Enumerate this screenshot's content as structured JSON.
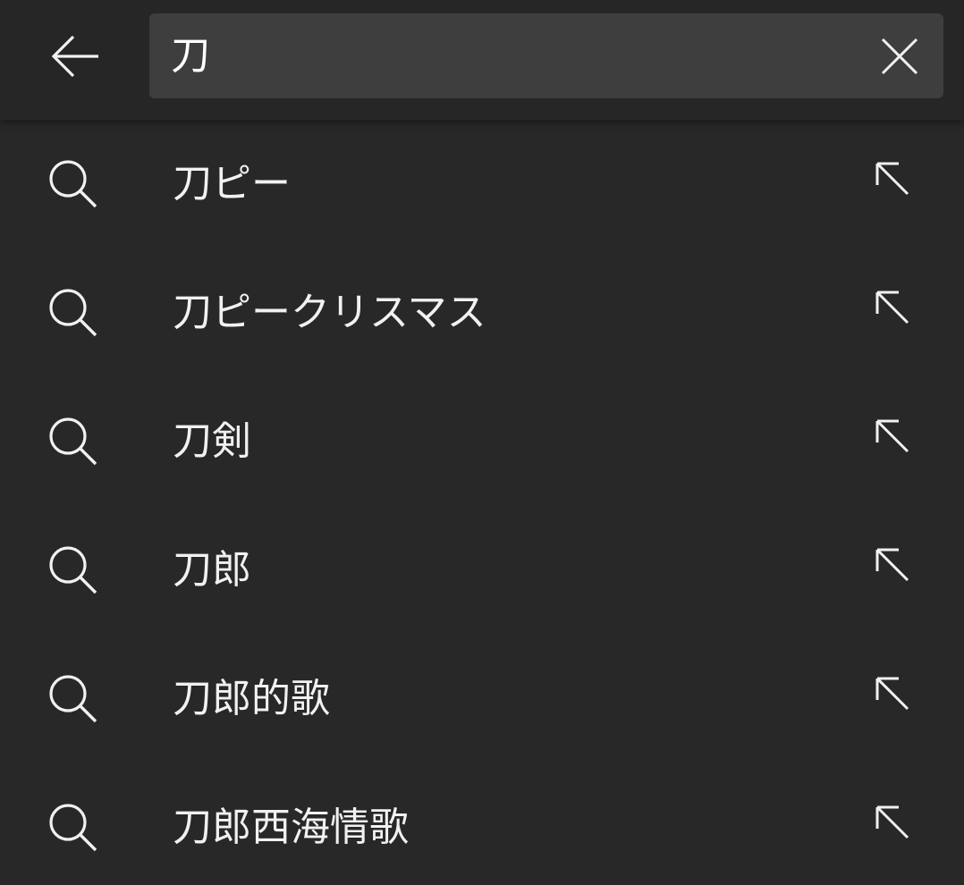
{
  "search": {
    "value": "刀",
    "icons": {
      "back": "arrow-left-icon",
      "clear": "close-icon"
    }
  },
  "suggestions": [
    {
      "text": "刀ピー",
      "icon": "search-icon",
      "action_icon": "arrow-up-left-icon"
    },
    {
      "text": "刀ピークリスマス",
      "icon": "search-icon",
      "action_icon": "arrow-up-left-icon"
    },
    {
      "text": "刀剣",
      "icon": "search-icon",
      "action_icon": "arrow-up-left-icon"
    },
    {
      "text": "刀郎",
      "icon": "search-icon",
      "action_icon": "arrow-up-left-icon"
    },
    {
      "text": "刀郎的歌",
      "icon": "search-icon",
      "action_icon": "arrow-up-left-icon"
    },
    {
      "text": "刀郎西海情歌",
      "icon": "search-icon",
      "action_icon": "arrow-up-left-icon"
    }
  ],
  "colors": {
    "background": "#282828",
    "topbar": "#262626",
    "search_box": "#3e3e3e",
    "text": "#f1f1f1"
  }
}
